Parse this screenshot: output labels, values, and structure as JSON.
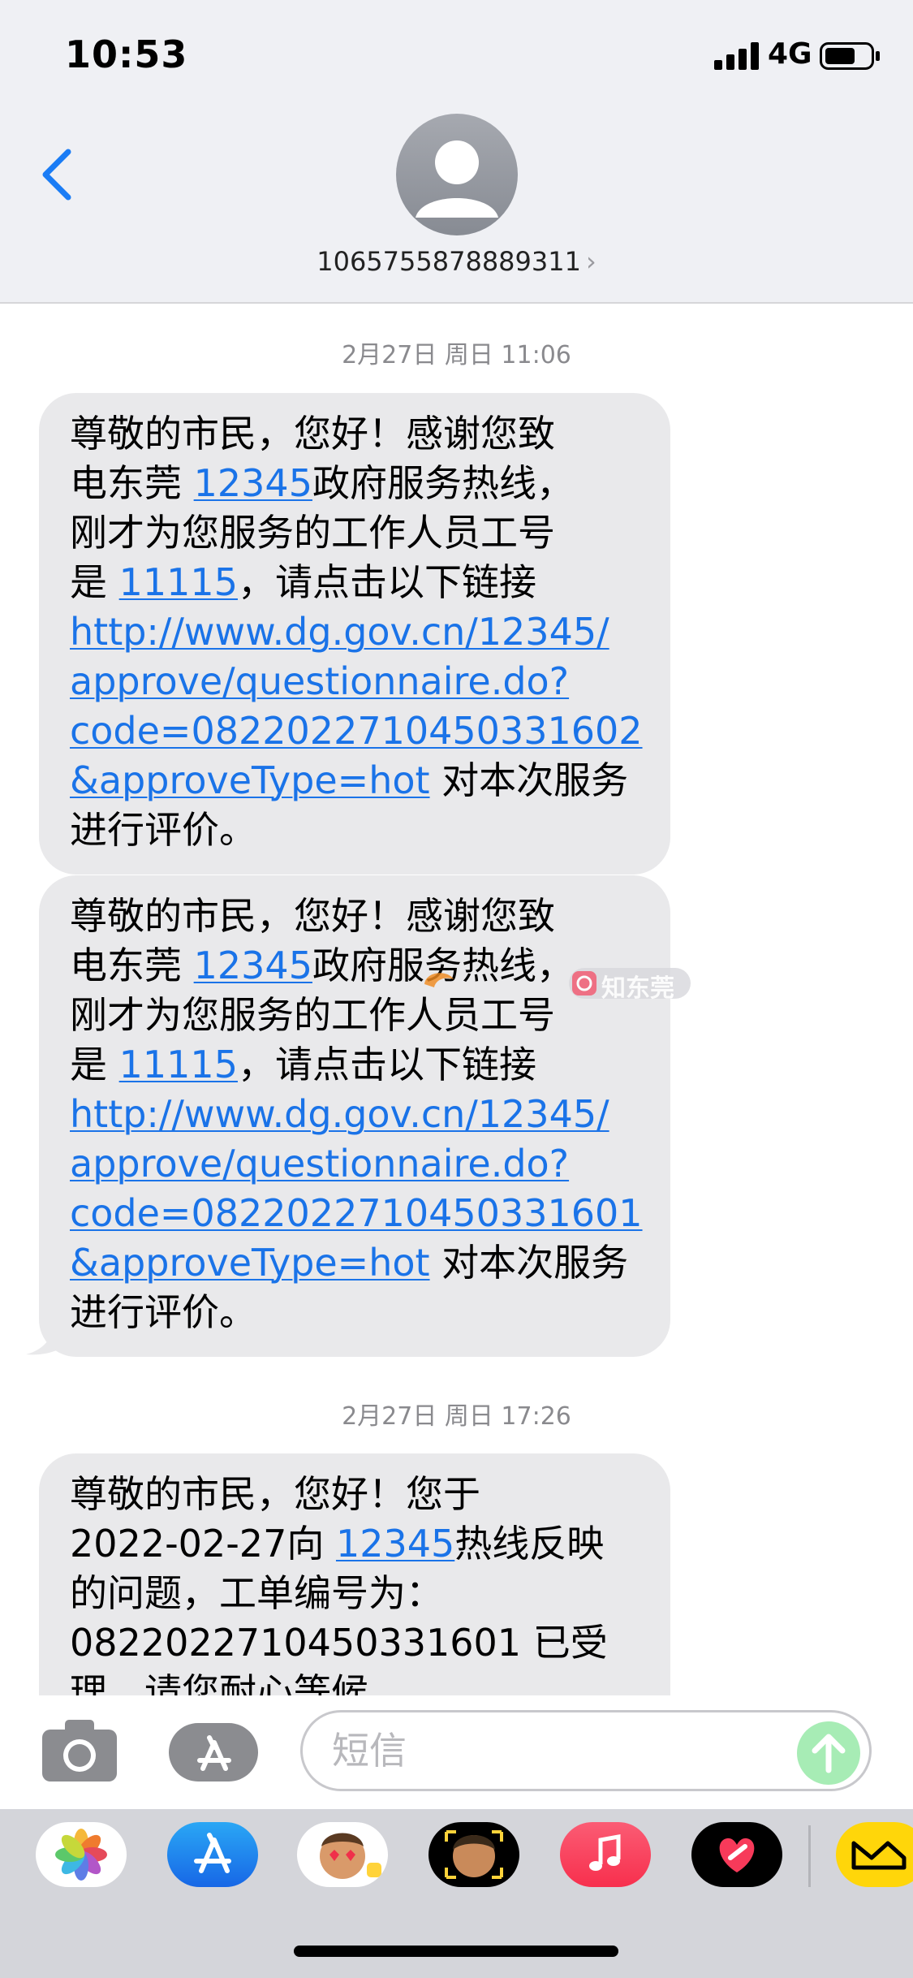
{
  "status_bar": {
    "time": "10:53",
    "network": "4G"
  },
  "header": {
    "sender_number": "1065755878889311",
    "chevron": "›"
  },
  "conversation": [
    {
      "timestamp": "2月27日 周日 11:06",
      "lines": [
        [
          {
            "t": "尊敬的市民，您好！感谢您致"
          }
        ],
        [
          {
            "t": "电东莞 "
          },
          {
            "t": "12345",
            "link": true
          },
          {
            "t": "政府服务热线，"
          }
        ],
        [
          {
            "t": "刚才为您服务的工作人员工号"
          }
        ],
        [
          {
            "t": "是 "
          },
          {
            "t": "11115",
            "link": true
          },
          {
            "t": "，请点击以下链接"
          }
        ],
        [
          {
            "t": "http://www.dg.gov.cn/12345/",
            "link": true
          }
        ],
        [
          {
            "t": "approve/questionnaire.do?",
            "link": true
          }
        ],
        [
          {
            "t": "code=0822022710450331602",
            "link": true
          }
        ],
        [
          {
            "t": "&approveType=hot",
            "link": true
          },
          {
            "t": " 对本次服务"
          }
        ],
        [
          {
            "t": "进行评价。"
          }
        ]
      ]
    },
    {
      "lines": [
        [
          {
            "t": "尊敬的市民，您好！感谢您致"
          }
        ],
        [
          {
            "t": "电东莞 "
          },
          {
            "t": "12345",
            "link": true
          },
          {
            "t": "政府服务热线，"
          }
        ],
        [
          {
            "t": "刚才为您服务的工作人员工号"
          }
        ],
        [
          {
            "t": "是 "
          },
          {
            "t": "11115",
            "link": true
          },
          {
            "t": "，请点击以下链接"
          }
        ],
        [
          {
            "t": "http://www.dg.gov.cn/12345/",
            "link": true
          }
        ],
        [
          {
            "t": "approve/questionnaire.do?",
            "link": true
          }
        ],
        [
          {
            "t": "code=0822022710450331601",
            "link": true
          }
        ],
        [
          {
            "t": "&approveType=hot",
            "link": true
          },
          {
            "t": " 对本次服务"
          }
        ],
        [
          {
            "t": "进行评价。"
          }
        ]
      ]
    },
    {
      "timestamp": "2月27日 周日 17:26",
      "lines": [
        [
          {
            "t": "尊敬的市民，您好！您于"
          }
        ],
        [
          {
            "t": "2022-02-27向 "
          },
          {
            "t": "12345",
            "link": true
          },
          {
            "t": "热线反映"
          }
        ],
        [
          {
            "t": "的问题，工单编号为："
          }
        ],
        [
          {
            "t": "0822022710450331601 已受"
          }
        ],
        [
          {
            "t": "理，请您耐心等候。"
          }
        ]
      ]
    }
  ],
  "input": {
    "placeholder": "短信"
  },
  "watermark": {
    "text": "知东莞"
  },
  "tray_apps": [
    "photos-app-icon",
    "app-store-app-icon",
    "memoji-app-icon",
    "animoji-app-icon",
    "music-app-icon",
    "fitness-app-icon",
    "wallet-app-icon"
  ],
  "colors": {
    "link": "#1a73e8",
    "bubble": "#e9e9eb",
    "header_bg": "#eff0f4",
    "send": "#a7ecb5"
  }
}
